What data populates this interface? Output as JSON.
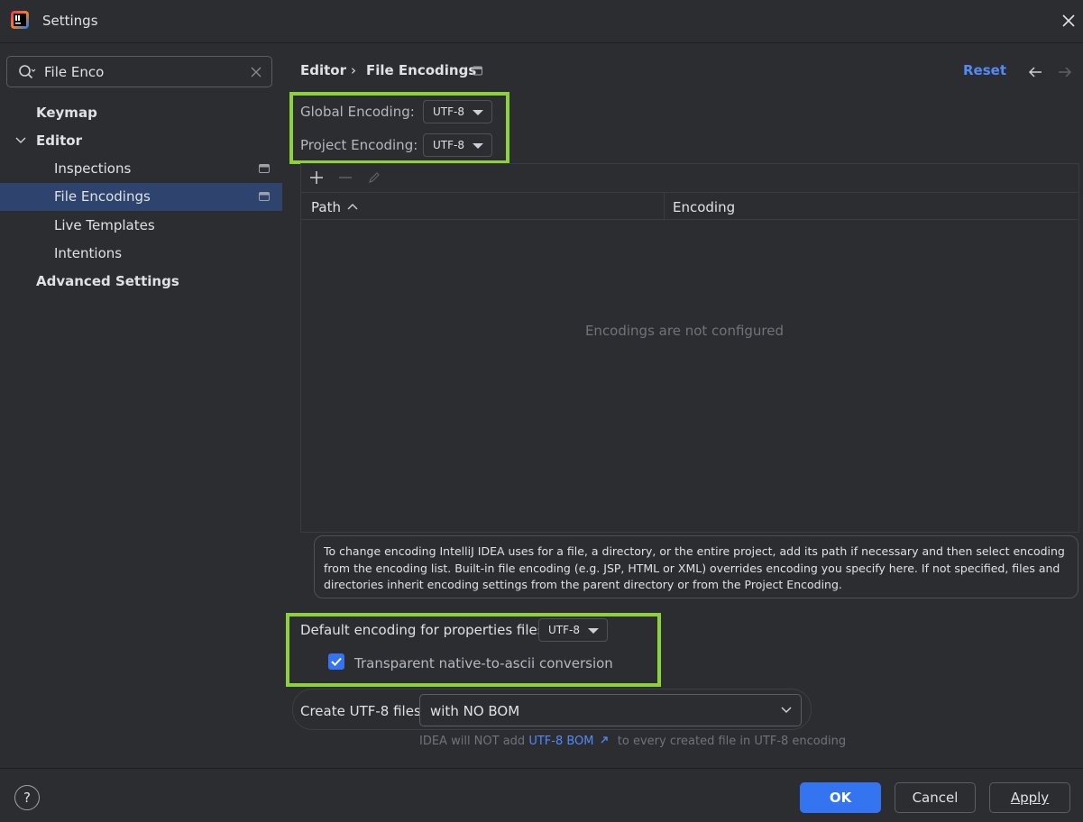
{
  "window": {
    "title": "Settings",
    "app_icon": "intellij-idea-icon",
    "close_icon": "close-icon"
  },
  "sidebar": {
    "search": {
      "value": "File Enco",
      "icon": "search-icon",
      "clear_icon": "clear-icon"
    },
    "items": [
      {
        "label": "Keymap",
        "bold": true
      },
      {
        "label": "Editor",
        "bold": true,
        "expanded": true
      },
      {
        "label": "Inspections",
        "page_icon": true
      },
      {
        "label": "File Encodings",
        "page_icon": true,
        "selected": true
      },
      {
        "label": "Live Templates"
      },
      {
        "label": "Intentions"
      },
      {
        "label": "Advanced Settings",
        "bold": true
      }
    ]
  },
  "header": {
    "breadcrumb": [
      "Editor",
      "File Encodings"
    ],
    "separator": "›",
    "reset_label": "Reset",
    "back_icon": "arrow-left-icon",
    "forward_icon": "arrow-right-icon"
  },
  "encodings": {
    "global_label": "Global Encoding:",
    "global_value": "UTF-8",
    "project_label": "Project Encoding:",
    "project_value": "UTF-8",
    "toolbar": {
      "add_icon": "plus-icon",
      "remove_icon": "minus-icon",
      "edit_icon": "pencil-icon"
    },
    "table": {
      "columns": [
        "Path",
        "Encoding"
      ],
      "sort_icon": "sort-ascending-icon",
      "empty_text": "Encodings are not configured"
    },
    "info": "To change encoding IntelliJ IDEA uses for a file, a directory, or the entire project, add its path if necessary and then select encoding from the encoding list. Built-in file encoding (e.g. JSP, HTML or XML) overrides encoding you specify here. If not specified, files and directories inherit encoding settings from the parent directory or from the Project Encoding.",
    "properties_label": "Default encoding for properties files:",
    "properties_value": "UTF-8",
    "transparent_label": "Transparent native-to-ascii conversion",
    "transparent_checked": true,
    "bom_label": "Create UTF-8 files:",
    "bom_value": "with NO BOM",
    "hint_prefix": "IDEA will NOT add",
    "hint_link": "UTF-8 BOM",
    "hint_link_icon": "external-link-icon",
    "hint_suffix": "to every created file in UTF-8 encoding"
  },
  "footer": {
    "help_label": "?",
    "ok_label": "OK",
    "cancel_label": "Cancel",
    "apply_label": "Apply"
  },
  "colors": {
    "accent": "#3574f0",
    "link": "#548af7",
    "selection": "#2e436e",
    "highlight_box": "#8dd13b"
  }
}
